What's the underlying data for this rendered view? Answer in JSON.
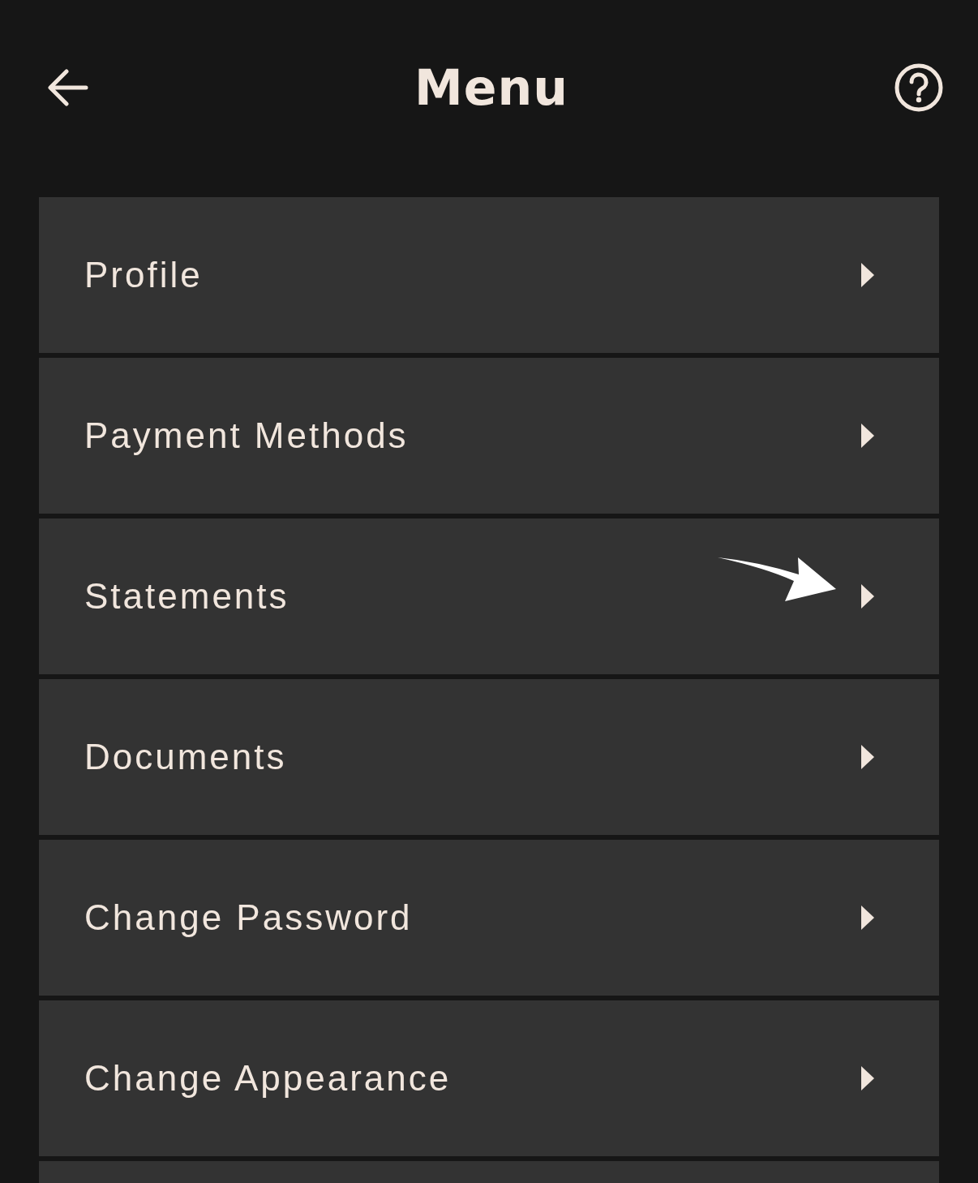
{
  "header": {
    "title": "Menu"
  },
  "items": [
    {
      "label": "Profile",
      "annotated": false
    },
    {
      "label": "Payment Methods",
      "annotated": false
    },
    {
      "label": "Statements",
      "annotated": true
    },
    {
      "label": "Documents",
      "annotated": false
    },
    {
      "label": "Change Password",
      "annotated": false
    },
    {
      "label": "Change Appearance",
      "annotated": false
    }
  ]
}
